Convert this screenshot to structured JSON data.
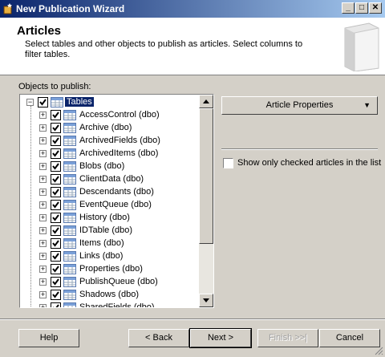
{
  "window": {
    "title": "New Publication Wizard"
  },
  "header": {
    "title": "Articles",
    "description": "Select tables and other objects to publish as articles. Select columns to filter tables."
  },
  "objects_label": "Objects to publish:",
  "tree": {
    "root": "Tables",
    "items": [
      "AccessControl (dbo)",
      "Archive (dbo)",
      "ArchivedFields (dbo)",
      "ArchivedItems (dbo)",
      "Blobs (dbo)",
      "ClientData (dbo)",
      "Descendants (dbo)",
      "EventQueue (dbo)",
      "History (dbo)",
      "IDTable (dbo)",
      "Items (dbo)",
      "Links (dbo)",
      "Properties (dbo)",
      "PublishQueue (dbo)",
      "Shadows (dbo)",
      "SharedFields (dbo)"
    ]
  },
  "article_properties_label": "Article Properties",
  "show_checked_label": "Show only checked articles in the list",
  "buttons": {
    "help": "Help",
    "back": "< Back",
    "next": "Next >",
    "finish": "Finish >>|",
    "cancel": "Cancel"
  }
}
